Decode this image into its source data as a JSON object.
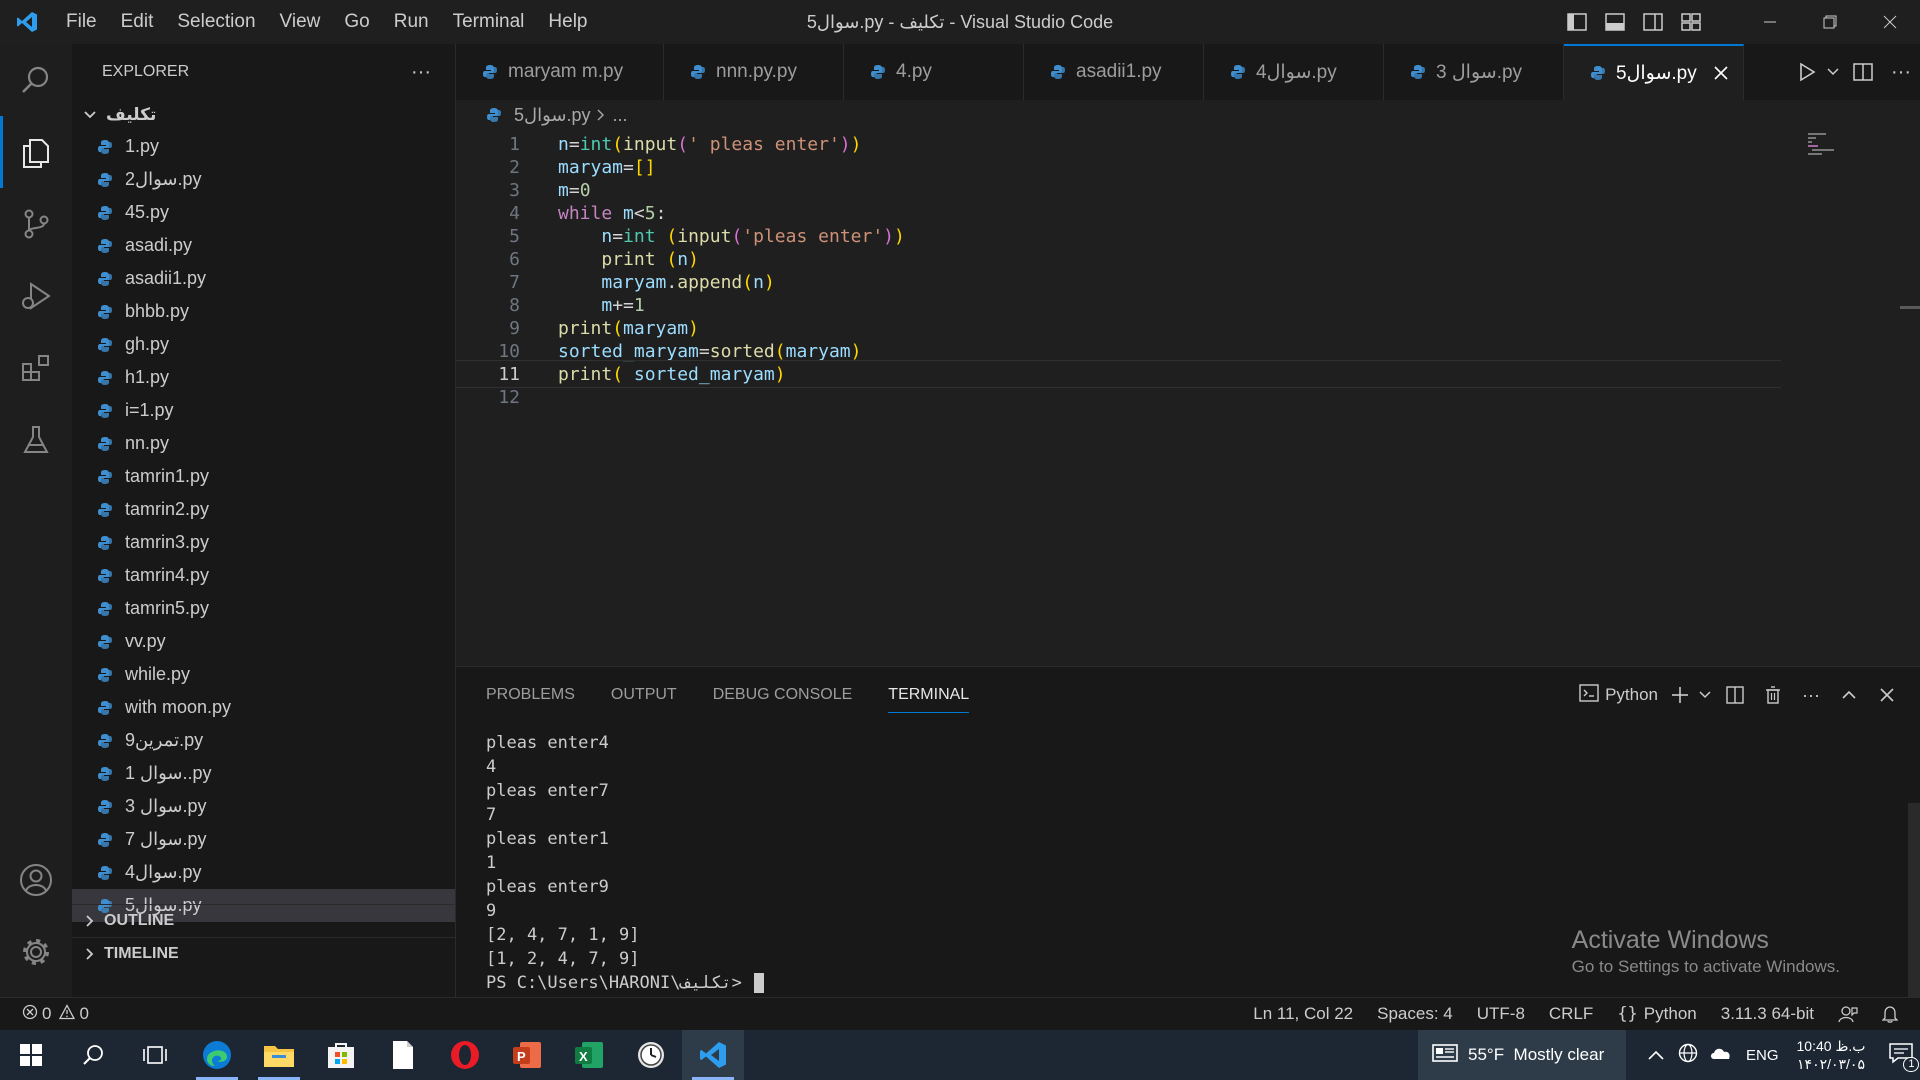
{
  "window": {
    "title": "5سوال.py - تکلیف - Visual Studio Code",
    "menu": [
      "File",
      "Edit",
      "Selection",
      "View",
      "Go",
      "Run",
      "Terminal",
      "Help"
    ]
  },
  "activity_bar": {
    "icons": [
      "search-icon",
      "explorer-icon",
      "source-control-icon",
      "run-debug-icon",
      "extensions-icon",
      "testing-icon",
      "account-icon",
      "settings-gear-icon"
    ]
  },
  "explorer": {
    "header": "EXPLORER",
    "more": "···",
    "folder": "تکلیف",
    "files": [
      "1.py",
      "2سوال.py",
      "45.py",
      "asadi.py",
      "asadii1.py",
      "bhbb.py",
      "gh.py",
      "h1.py",
      "i=1.py",
      "nn.py",
      "tamrin1.py",
      "tamrin2.py",
      "tamrin3.py",
      "tamrin4.py",
      "tamrin5.py",
      "vv.py",
      "while.py",
      "with moon.py",
      "9تمرین.py",
      "1 سوال..py",
      "3 سوال.py",
      "7 سوال.py",
      "4سوال.py",
      "5سوال.py"
    ],
    "selected_index": 23,
    "outline": "OUTLINE",
    "timeline": "TIMELINE"
  },
  "tabs": [
    {
      "label": "maryam m.py",
      "active": false
    },
    {
      "label": "nnn.py.py",
      "active": false
    },
    {
      "label": "4.py",
      "active": false
    },
    {
      "label": "asadii1.py",
      "active": false
    },
    {
      "label": "4سوال.py",
      "active": false
    },
    {
      "label": "3 سوال.py",
      "active": false
    },
    {
      "label": "5سوال.py",
      "active": true
    }
  ],
  "breadcrumb": {
    "file": "5سوال.py",
    "rest": "..."
  },
  "editor": {
    "line_numbers": [
      "1",
      "2",
      "3",
      "4",
      "5",
      "6",
      "7",
      "8",
      "9",
      "10",
      "11",
      "12"
    ],
    "current_line": 11,
    "lines": [
      "n=int(input(' pleas enter'))",
      "maryam=[]",
      "m=0",
      "while m<5:",
      "    n=int (input('pleas enter'))",
      "    print (n)",
      "    maryam.append(n)",
      "    m+=1",
      "print(maryam)",
      "sorted_maryam=sorted(maryam)",
      "print( sorted_maryam)",
      ""
    ]
  },
  "panel": {
    "tabs": [
      "PROBLEMS",
      "OUTPUT",
      "DEBUG CONSOLE",
      "TERMINAL"
    ],
    "active_tab": "TERMINAL",
    "shell": "Python",
    "terminal_lines": [
      "pleas enter4",
      "4",
      "pleas enter7",
      "7",
      "pleas enter1",
      "1",
      "pleas enter9",
      "9",
      "[2, 4, 7, 1, 9]",
      "[1, 2, 4, 7, 9]"
    ],
    "prompt": "PS C:\\Users\\HARONI\\تکلیف>",
    "watermark_title": "Activate Windows",
    "watermark_sub": "Go to Settings to activate Windows."
  },
  "statusbar": {
    "errors": "0",
    "warnings": "0",
    "position": "Ln 11, Col 22",
    "spaces": "Spaces: 4",
    "encoding": "UTF-8",
    "eol": "CRLF",
    "language": "Python",
    "interpreter": "3.11.3 64-bit"
  },
  "taskbar": {
    "apps": [
      "windows-start-icon",
      "search-icon",
      "task-view-icon",
      "edge-icon",
      "file-explorer-icon",
      "store-icon",
      "notepad-icon",
      "opera-icon",
      "powerpoint-icon",
      "excel-icon",
      "clock-app-icon",
      "vscode-icon"
    ],
    "weather": "55°F  Mostly clear",
    "language": "ENG",
    "time": "10:40 ب.ظ",
    "date": "۱۴۰۲/۰۳/۰۵",
    "notif_count": "1"
  },
  "colors": {
    "accent": "#0078d4",
    "keyword": "#c586c0",
    "function": "#dcdcaa",
    "string": "#ce9178",
    "variable": "#9cdcfe",
    "number": "#b5cea8",
    "python_icon": "#3e8ed0"
  }
}
